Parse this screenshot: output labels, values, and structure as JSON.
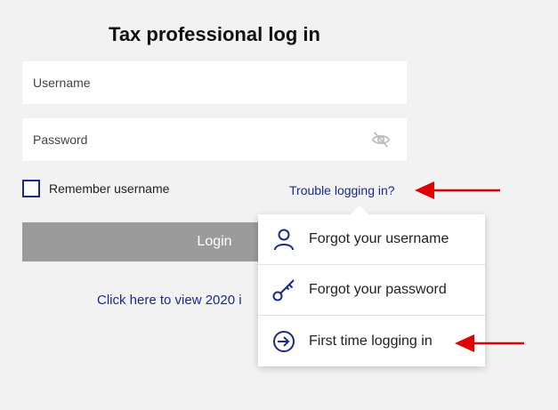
{
  "title": "Tax professional log in",
  "username": {
    "placeholder": "Username",
    "value": ""
  },
  "password": {
    "placeholder": "Password",
    "value": ""
  },
  "remember": {
    "label": "Remember username",
    "checked": false
  },
  "trouble_link": "Trouble logging in?",
  "login_button": "Login",
  "view_link": "Click here to view 2020 i",
  "dropdown": {
    "items": [
      {
        "label": "Forgot your username",
        "icon": "user-icon"
      },
      {
        "label": "Forgot your password",
        "icon": "key-icon"
      },
      {
        "label": "First time logging in",
        "icon": "sign-in-icon"
      }
    ]
  },
  "colors": {
    "accent": "#1b2a8a",
    "annotation": "#e00000",
    "button_disabled": "#9b9b9b"
  }
}
